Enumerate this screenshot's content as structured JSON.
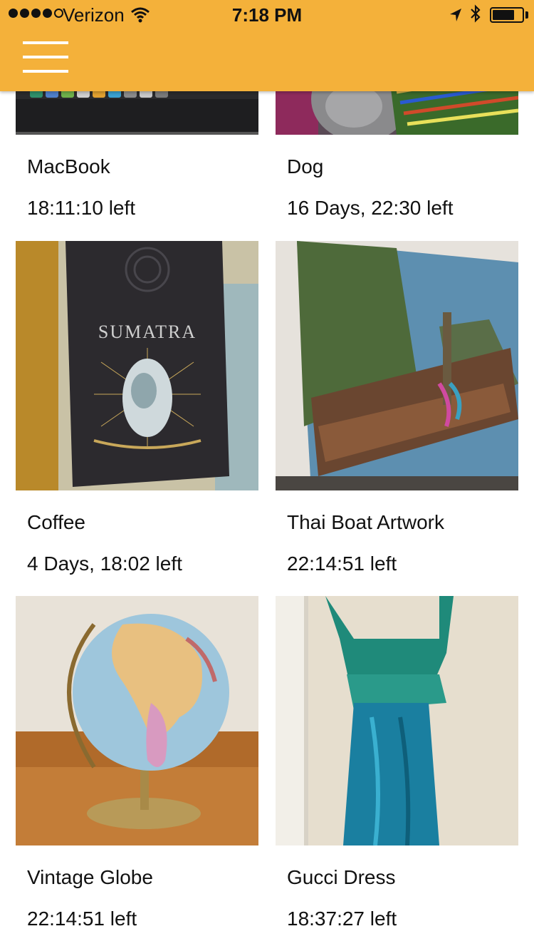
{
  "status_bar": {
    "carrier": "Verizon",
    "time": "7:18 PM",
    "battery_level": 0.75,
    "signal_bars": 4
  },
  "header": {
    "background_color": "#f4b13a",
    "menu_icon": "hamburger-menu-icon"
  },
  "items": [
    {
      "title": "MacBook",
      "time_left": "18:11:10 left"
    },
    {
      "title": "Dog",
      "time_left": "16 Days, 22:30 left"
    },
    {
      "title": "Coffee",
      "time_left": "4 Days, 18:02 left"
    },
    {
      "title": "Thai Boat Artwork",
      "time_left": "22:14:51 left"
    },
    {
      "title": "Vintage Globe",
      "time_left": "22:14:51 left"
    },
    {
      "title": "Gucci Dress",
      "time_left": "18:37:27 left"
    }
  ]
}
